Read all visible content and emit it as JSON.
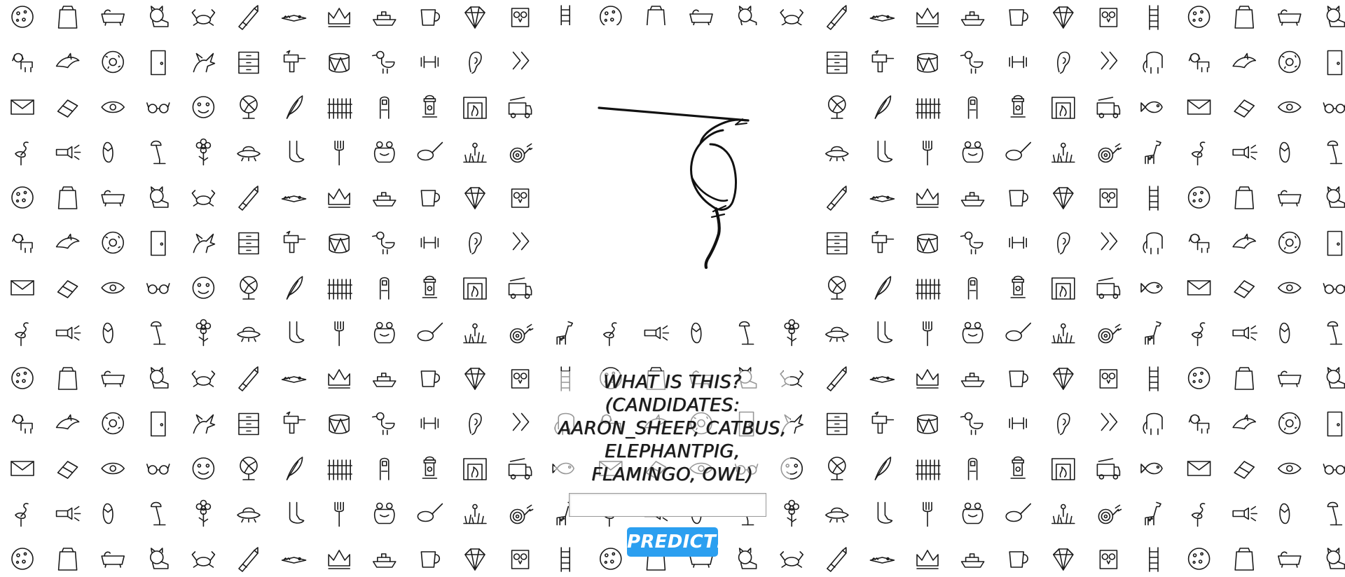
{
  "question": {
    "text": "WHAT IS THIS? (CANDIDATES: AARON_SHEEP, CATBUS, ELEPHANTPIG, FLAMINGO, OWL)"
  },
  "answer_input": {
    "value": "",
    "placeholder": ""
  },
  "predict_button": {
    "label": "PREDICT!"
  },
  "colors": {
    "button": "#2b9ff0",
    "ink": "#1a1a1a"
  },
  "background": {
    "icons": [
      "cookie-icon",
      "paper-bag-icon",
      "bathtub-icon",
      "cat-icon",
      "crab-icon",
      "crayon-icon",
      "alligator-icon",
      "crown-icon",
      "cruise-ship-icon",
      "cup-icon",
      "diamond-icon",
      "owl-icon",
      "ladder-icon",
      "dog-icon",
      "dolphin-icon",
      "donut-icon",
      "door-icon",
      "dragon-icon",
      "dresser-icon",
      "drill-icon",
      "drum-icon",
      "duck-icon",
      "dumbbell-icon",
      "ear-icon",
      "zigzag-icon",
      "elephant-icon",
      "envelope-icon",
      "eraser-icon",
      "eye-icon",
      "eyeglasses-icon",
      "face-icon",
      "fan-icon",
      "feather-icon",
      "fence-icon",
      "finger-icon",
      "fire-hydrant-icon",
      "fireplace-icon",
      "firetruck-icon",
      "fish-icon",
      "flamingo-icon",
      "flashlight-icon",
      "flip-flops-icon",
      "floor-lamp-icon",
      "flower-icon",
      "flying-saucer-icon",
      "foot-icon",
      "fork-icon",
      "frog-icon",
      "frying-pan-icon",
      "garden-icon",
      "garden-hose-icon",
      "giraffe-icon"
    ]
  }
}
